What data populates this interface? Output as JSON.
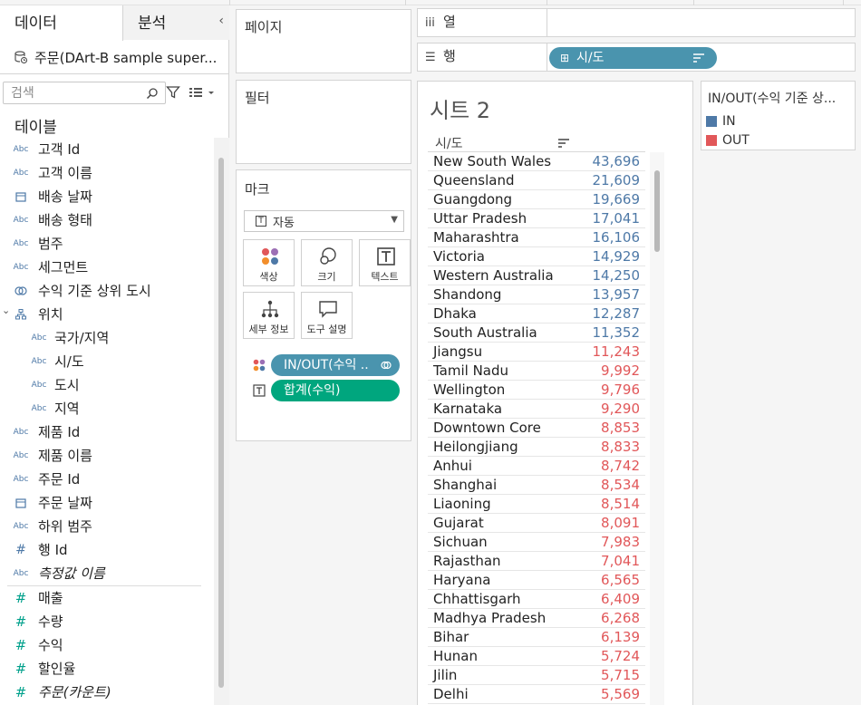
{
  "colors": {
    "in": "#4e79a7",
    "out": "#e15759",
    "pill_blue": "#4a94ae",
    "pill_green": "#00a67e"
  },
  "data_pane": {
    "tab_data": "데이터",
    "tab_analysis": "분석",
    "collapse_icon": "chevron-left-icon",
    "datasource": "주문(DArt-B sample super...",
    "search_placeholder": "검색",
    "tables_title": "테이블",
    "fields": [
      {
        "type": "Abc",
        "label": "고객 Id",
        "indent": 0
      },
      {
        "type": "Abc",
        "label": "고객 이름",
        "indent": 0
      },
      {
        "type": "date",
        "label": "배송 날짜",
        "indent": 0
      },
      {
        "type": "Abc",
        "label": "배송 형태",
        "indent": 0
      },
      {
        "type": "Abc",
        "label": "범주",
        "indent": 0
      },
      {
        "type": "Abc",
        "label": "세그먼트",
        "indent": 0
      },
      {
        "type": "set",
        "label": "수익 기준 상위 도시",
        "indent": 0
      },
      {
        "type": "hier",
        "label": "위치",
        "indent": 0
      },
      {
        "type": "Abc",
        "label": "국가/지역",
        "indent": 1
      },
      {
        "type": "Abc",
        "label": "시/도",
        "indent": 1
      },
      {
        "type": "Abc",
        "label": "도시",
        "indent": 1
      },
      {
        "type": "Abc",
        "label": "지역",
        "indent": 1
      },
      {
        "type": "Abc",
        "label": "제품 Id",
        "indent": 0
      },
      {
        "type": "Abc",
        "label": "제품 이름",
        "indent": 0
      },
      {
        "type": "Abc",
        "label": "주문 Id",
        "indent": 0
      },
      {
        "type": "date",
        "label": "주문 날짜",
        "indent": 0
      },
      {
        "type": "Abc",
        "label": "하위 범주",
        "indent": 0
      },
      {
        "type": "num",
        "label": "행 Id",
        "indent": 0
      },
      {
        "type": "Abc",
        "label": "측정값 이름",
        "indent": 0,
        "italic": true
      }
    ],
    "measures": [
      {
        "label": "매출"
      },
      {
        "label": "수량"
      },
      {
        "label": "수익"
      },
      {
        "label": "할인율"
      },
      {
        "label": "주문(카운트)",
        "italic": true
      }
    ]
  },
  "shelves": {
    "pages": "페이지",
    "filters": "필터",
    "marks": "마크",
    "mark_type": "자동",
    "mark_buttons": {
      "color": "색상",
      "size": "크기",
      "text": "텍스트",
      "detail": "세부 정보",
      "tooltip": "도구 설명"
    },
    "color_pill": "IN/OUT(수익 ..",
    "text_pill": "합계(수익)",
    "columns_label": "열",
    "rows_label": "행",
    "rows_pill": "시/도"
  },
  "sheet": {
    "title": "시트 2",
    "column_header": "시/도",
    "rows": [
      {
        "name": "New South Wales",
        "value": "43,696",
        "status": "IN"
      },
      {
        "name": "Queensland",
        "value": "21,609",
        "status": "IN"
      },
      {
        "name": "Guangdong",
        "value": "19,669",
        "status": "IN"
      },
      {
        "name": "Uttar Pradesh",
        "value": "17,041",
        "status": "IN"
      },
      {
        "name": "Maharashtra",
        "value": "16,106",
        "status": "IN"
      },
      {
        "name": "Victoria",
        "value": "14,929",
        "status": "IN"
      },
      {
        "name": "Western Australia",
        "value": "14,250",
        "status": "IN"
      },
      {
        "name": "Shandong",
        "value": "13,957",
        "status": "IN"
      },
      {
        "name": "Dhaka",
        "value": "12,287",
        "status": "IN"
      },
      {
        "name": "South Australia",
        "value": "11,352",
        "status": "IN"
      },
      {
        "name": "Jiangsu",
        "value": "11,243",
        "status": "OUT"
      },
      {
        "name": "Tamil Nadu",
        "value": "9,992",
        "status": "OUT"
      },
      {
        "name": "Wellington",
        "value": "9,796",
        "status": "OUT"
      },
      {
        "name": "Karnataka",
        "value": "9,290",
        "status": "OUT"
      },
      {
        "name": "Downtown Core",
        "value": "8,853",
        "status": "OUT"
      },
      {
        "name": "Heilongjiang",
        "value": "8,833",
        "status": "OUT"
      },
      {
        "name": "Anhui",
        "value": "8,742",
        "status": "OUT"
      },
      {
        "name": "Shanghai",
        "value": "8,534",
        "status": "OUT"
      },
      {
        "name": "Liaoning",
        "value": "8,514",
        "status": "OUT"
      },
      {
        "name": "Gujarat",
        "value": "8,091",
        "status": "OUT"
      },
      {
        "name": "Sichuan",
        "value": "7,983",
        "status": "OUT"
      },
      {
        "name": "Rajasthan",
        "value": "7,041",
        "status": "OUT"
      },
      {
        "name": "Haryana",
        "value": "6,565",
        "status": "OUT"
      },
      {
        "name": "Chhattisgarh",
        "value": "6,409",
        "status": "OUT"
      },
      {
        "name": "Madhya Pradesh",
        "value": "6,268",
        "status": "OUT"
      },
      {
        "name": "Bihar",
        "value": "6,139",
        "status": "OUT"
      },
      {
        "name": "Hunan",
        "value": "5,724",
        "status": "OUT"
      },
      {
        "name": "Jilin",
        "value": "5,715",
        "status": "OUT"
      },
      {
        "name": "Delhi",
        "value": "5,569",
        "status": "OUT"
      }
    ]
  },
  "legend": {
    "title": "IN/OUT(수익 기준 상...",
    "items": [
      {
        "label": "IN",
        "key": "in"
      },
      {
        "label": "OUT",
        "key": "out"
      }
    ]
  }
}
